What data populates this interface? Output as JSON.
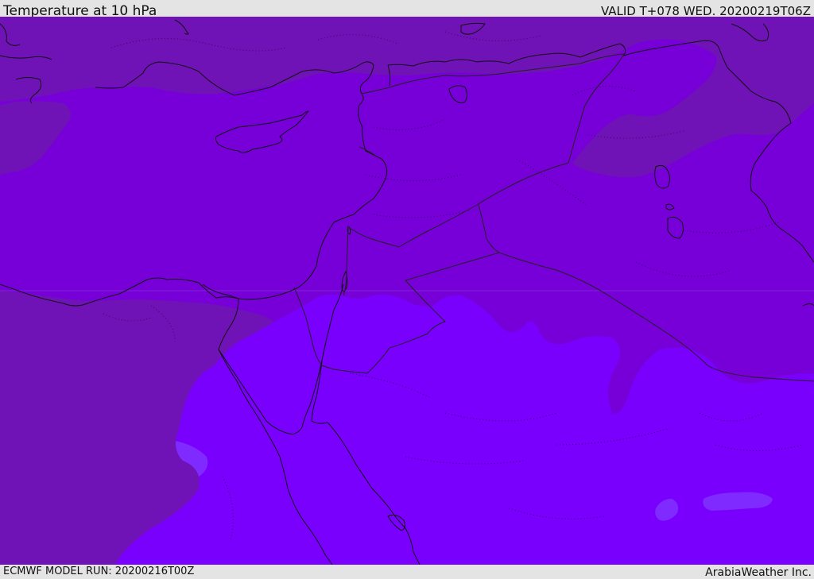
{
  "header": {
    "title": "Temperature at 10 hPa",
    "valid": "VALID T+078 WED. 20200219T06Z"
  },
  "footer": {
    "model_run": "ECMWF MODEL RUN: 20200216T00Z",
    "credit": "ArabiaWeather Inc."
  },
  "map": {
    "region": "Eastern Mediterranean / Middle East",
    "field": "temperature",
    "colors": {
      "dark_band": "#6f12b6",
      "mid_band": "#7700d8",
      "light_band": "#7a00fe",
      "pale_patch": "#7f2bff",
      "coastline": "#111111",
      "border": "#222222"
    }
  }
}
